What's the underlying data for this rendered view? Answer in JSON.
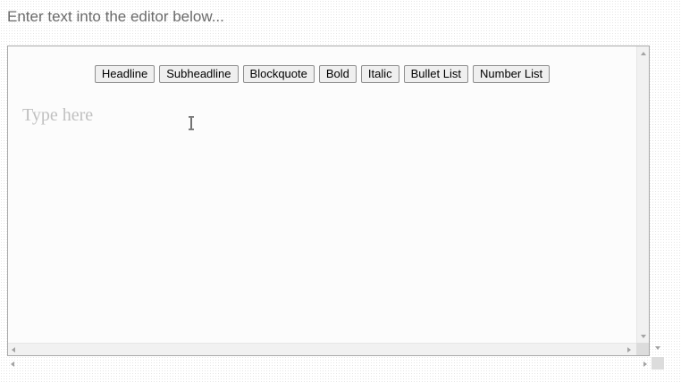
{
  "page": {
    "instruction": "Enter text into the editor below..."
  },
  "toolbar": {
    "buttons": [
      {
        "label": "Headline",
        "name": "headline-button"
      },
      {
        "label": "Subheadline",
        "name": "subheadline-button"
      },
      {
        "label": "Blockquote",
        "name": "blockquote-button"
      },
      {
        "label": "Bold",
        "name": "bold-button"
      },
      {
        "label": "Italic",
        "name": "italic-button"
      },
      {
        "label": "Bullet List",
        "name": "bullet-list-button"
      },
      {
        "label": "Number List",
        "name": "number-list-button"
      }
    ]
  },
  "editor": {
    "placeholder": "Type here",
    "cursor_icon": "text-cursor-icon"
  },
  "colors": {
    "placeholder": "#c0c0c0",
    "instruction": "#6b6b6b",
    "frame_border": "#a9a9a9"
  }
}
